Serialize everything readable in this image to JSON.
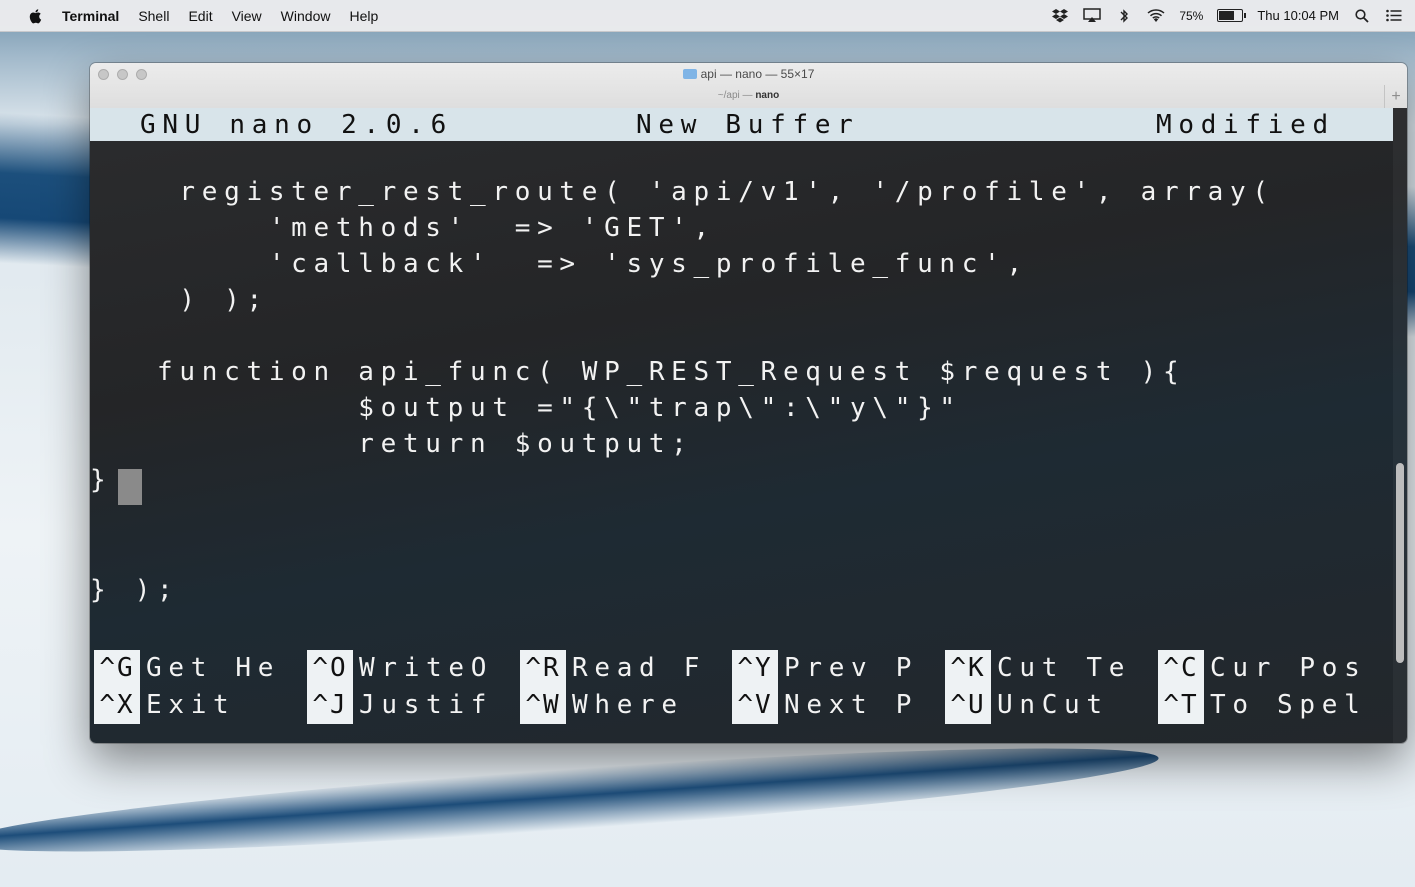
{
  "menubar": {
    "app_name": "Terminal",
    "items": [
      "Shell",
      "Edit",
      "View",
      "Window",
      "Help"
    ],
    "battery_percent": "75%",
    "battery_level": 0.75,
    "clock": "Thu 10:04 PM"
  },
  "window": {
    "title": "api — nano — 55×17",
    "subtitle_path": "~/api",
    "subtitle_sep": " — ",
    "subtitle_proc": "nano",
    "new_tab_symbol": "+"
  },
  "nano": {
    "version": "GNU nano 2.0.6",
    "buffer": "New Buffer",
    "status": "Modified",
    "code_lines": [
      "    register_rest_route( 'api/v1', '/profile', array(",
      "        'methods'  => 'GET',",
      "        'callback'  => 'sys_profile_func',",
      "    ) );",
      "",
      "   function api_func( WP_REST_Request $request ){",
      "            $output =\"{\\\"trap\\\":\\\"y\\\"}\"",
      "            return $output;",
      "}",
      "",
      "",
      "} );"
    ],
    "shortcuts_row1": [
      {
        "key": "^G",
        "label": "Get He"
      },
      {
        "key": "^O",
        "label": "WriteO"
      },
      {
        "key": "^R",
        "label": "Read F"
      },
      {
        "key": "^Y",
        "label": "Prev P"
      },
      {
        "key": "^K",
        "label": "Cut Te"
      },
      {
        "key": "^C",
        "label": "Cur Pos"
      }
    ],
    "shortcuts_row2": [
      {
        "key": "^X",
        "label": "Exit"
      },
      {
        "key": "^J",
        "label": "Justif"
      },
      {
        "key": "^W",
        "label": "Where"
      },
      {
        "key": "^V",
        "label": "Next P"
      },
      {
        "key": "^U",
        "label": "UnCut"
      },
      {
        "key": "^T",
        "label": "To Spel"
      }
    ]
  },
  "icons": [
    "apple-icon",
    "dropbox-icon",
    "airplay-icon",
    "bluetooth-icon",
    "wifi-icon",
    "battery-icon",
    "spotlight-icon",
    "notification-center-icon",
    "folder-icon"
  ]
}
